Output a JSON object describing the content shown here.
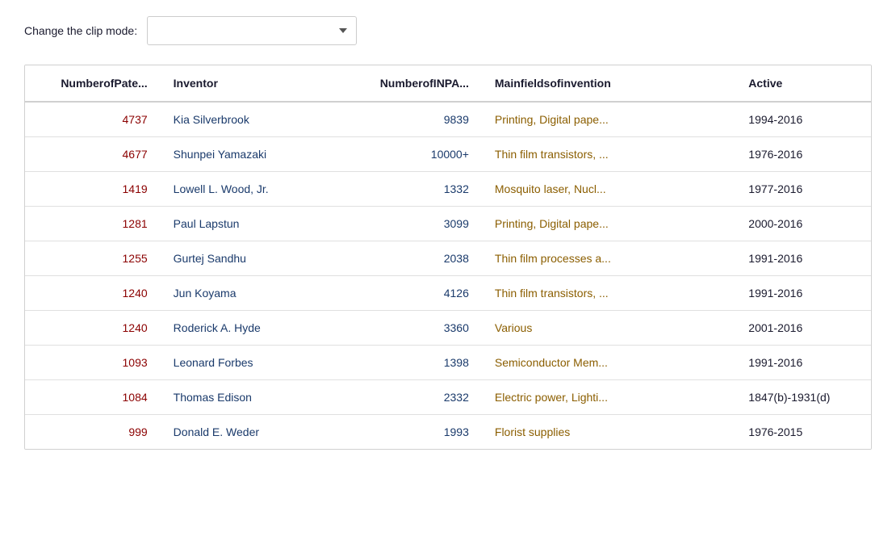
{
  "clip_mode": {
    "label": "Change the clip mode:",
    "placeholder": "",
    "options": []
  },
  "table": {
    "columns": [
      {
        "key": "num_patents",
        "label": "NumberofPate...",
        "align": "right"
      },
      {
        "key": "inventor",
        "label": "Inventor",
        "align": "left"
      },
      {
        "key": "num_inpa",
        "label": "NumberofINPA...",
        "align": "right"
      },
      {
        "key": "fields",
        "label": "Mainfieldsofinvention",
        "align": "left"
      },
      {
        "key": "active",
        "label": "Active",
        "align": "left"
      }
    ],
    "rows": [
      {
        "num_patents": "4737",
        "inventor": "Kia Silverbrook",
        "num_inpa": "9839",
        "fields": "Printing, Digital pape...",
        "active": "1994-2016"
      },
      {
        "num_patents": "4677",
        "inventor": "Shunpei Yamazaki",
        "num_inpa": "10000+",
        "fields": "Thin film transistors, ...",
        "active": "1976-2016"
      },
      {
        "num_patents": "1419",
        "inventor": "Lowell L. Wood, Jr.",
        "num_inpa": "1332",
        "fields": "Mosquito laser, Nucl...",
        "active": "1977-2016"
      },
      {
        "num_patents": "1281",
        "inventor": "Paul Lapstun",
        "num_inpa": "3099",
        "fields": "Printing, Digital pape...",
        "active": "2000-2016"
      },
      {
        "num_patents": "1255",
        "inventor": "Gurtej Sandhu",
        "num_inpa": "2038",
        "fields": "Thin film processes a...",
        "active": "1991-2016"
      },
      {
        "num_patents": "1240",
        "inventor": "Jun Koyama",
        "num_inpa": "4126",
        "fields": "Thin film transistors, ...",
        "active": "1991-2016"
      },
      {
        "num_patents": "1240",
        "inventor": "Roderick A. Hyde",
        "num_inpa": "3360",
        "fields": "Various",
        "active": "2001-2016"
      },
      {
        "num_patents": "1093",
        "inventor": "Leonard Forbes",
        "num_inpa": "1398",
        "fields": "Semiconductor Mem...",
        "active": "1991-2016"
      },
      {
        "num_patents": "1084",
        "inventor": "Thomas Edison",
        "num_inpa": "2332",
        "fields": "Electric power, Lighti...",
        "active": "1847(b)-1931(d)"
      },
      {
        "num_patents": "999",
        "inventor": "Donald E. Weder",
        "num_inpa": "1993",
        "fields": "Florist supplies",
        "active": "1976-2015"
      }
    ]
  }
}
